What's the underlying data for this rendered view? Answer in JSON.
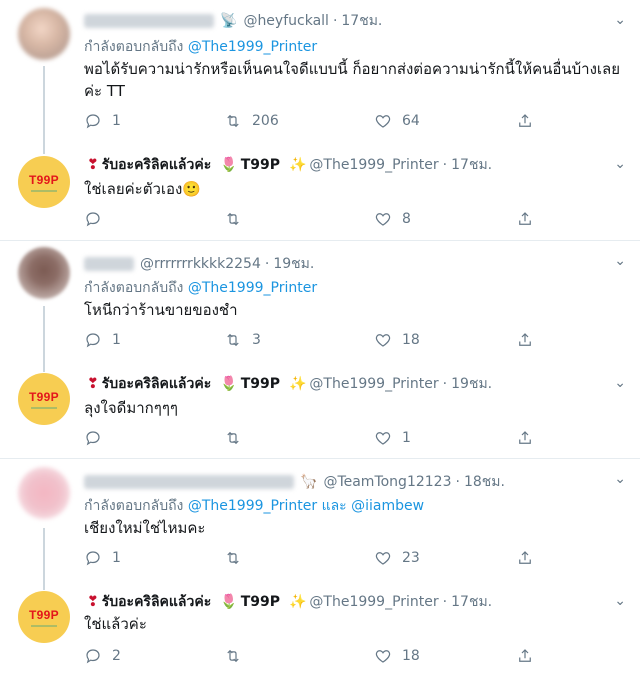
{
  "replying_label": "กำลังตอบกลับถึง",
  "and_label": "และ",
  "t99p_logo": "T99P",
  "tweets": [
    {
      "handle": "@heyfuckall",
      "time": "17ชม.",
      "reply_to": "@The1999_Printer",
      "text_line1": "พอได้รับความน่ารักหรือเห็นคนใจดีแบบนี้ ก็อยากส่งต่อความน่ารักนี้ให้คนอื่นบ้างเลย",
      "text_line2": "ค่ะ TT",
      "replies": "1",
      "retweets": "206",
      "likes": "64"
    },
    {
      "name": "รับอะคริลิคแล้วค่ะ",
      "name_suffix": "T99P",
      "handle": "@The1999_Printer",
      "time": "17ชม.",
      "text": "ใช่เลยค่ะตัวเอง🙂",
      "replies": "",
      "retweets": "",
      "likes": "8"
    },
    {
      "handle": "@rrrrrrrkkkk2254",
      "time": "19ชม.",
      "reply_to": "@The1999_Printer",
      "text": "โหนีกว่าร้านขายของชำ",
      "replies": "1",
      "retweets": "3",
      "likes": "18"
    },
    {
      "name": "รับอะคริลิคแล้วค่ะ",
      "name_suffix": "T99P",
      "handle": "@The1999_Printer",
      "time": "19ชม.",
      "text": "ลุงใจดีมากๆๆๆ",
      "replies": "",
      "retweets": "",
      "likes": "1"
    },
    {
      "handle": "@TeamTong12123",
      "time": "18ชม.",
      "reply_to": "@The1999_Printer",
      "reply_to2": "@iiambew",
      "text": "เชียงใหม่ใช่ไหมคะ",
      "replies": "1",
      "retweets": "",
      "likes": "23"
    },
    {
      "name": "รับอะคริลิคแล้วค่ะ",
      "name_suffix": "T99P",
      "handle": "@The1999_Printer",
      "time": "17ชม.",
      "text": "ใช่แล้วค่ะ",
      "replies": "2",
      "retweets": "",
      "likes": "18"
    }
  ],
  "icons": {
    "reply": "reply-icon",
    "retweet": "retweet-icon",
    "like": "heart-icon",
    "share": "share-icon",
    "more": "chevron-down-icon"
  },
  "colors": {
    "link": "#1b95e0",
    "muted": "#657786",
    "avatar_t99p": "#f7cd52",
    "t99p_text": "#e3161b"
  }
}
